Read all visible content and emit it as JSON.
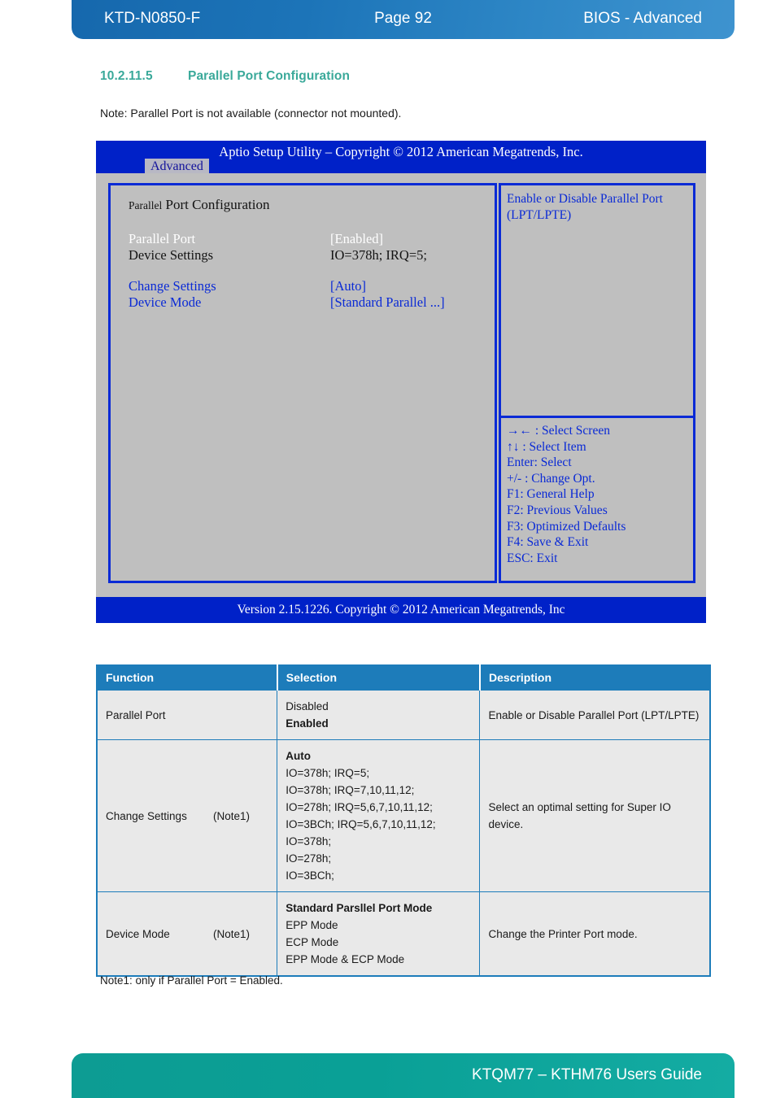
{
  "header": {
    "doc_id": "KTD-N0850-F",
    "page": "Page 92",
    "section": "BIOS - Advanced"
  },
  "section": {
    "number": "10.2.11.5",
    "title": "Parallel Port Configuration",
    "note": "Note: Parallel Port is not available (connector not mounted)."
  },
  "bios": {
    "title": "Aptio Setup Utility  –  Copyright © 2012 American Megatrends, Inc.",
    "tab": "Advanced",
    "panel_title_small": "Parallel",
    "panel_title_rest": " Port Configuration",
    "rows": [
      {
        "label": "Parallel Port",
        "value": "[Enabled]"
      },
      {
        "label": "Device Settings",
        "value": "IO=378h; IRQ=5;"
      },
      {
        "label": "Change Settings",
        "value": "[Auto]"
      },
      {
        "label": "Device Mode",
        "value": "[Standard Parallel ...]"
      }
    ],
    "help": "Enable or Disable Parallel Port (LPT/LPTE)",
    "keys": [
      "→← : Select Screen",
      "↑↓ : Select Item",
      "Enter: Select",
      "+/- : Change Opt.",
      "F1: General Help",
      "F2: Previous Values",
      "F3: Optimized Defaults",
      "F4: Save & Exit",
      "ESC: Exit"
    ],
    "version": "Version 2.15.1226. Copyright © 2012 American Megatrends, Inc"
  },
  "table": {
    "headers": {
      "function": "Function",
      "selection": "Selection",
      "description": "Description"
    },
    "rows": [
      {
        "function": "Parallel Port",
        "note": "",
        "options": [
          {
            "text": "Disabled",
            "bold": false
          },
          {
            "text": "Enabled",
            "bold": true
          }
        ],
        "description": "Enable or Disable Parallel Port (LPT/LPTE)"
      },
      {
        "function": "Change Settings",
        "note": "(Note1)",
        "options": [
          {
            "text": "Auto",
            "bold": true
          },
          {
            "text": "IO=378h; IRQ=5;",
            "bold": false
          },
          {
            "text": "IO=378h; IRQ=7,10,11,12;",
            "bold": false
          },
          {
            "text": "IO=278h; IRQ=5,6,7,10,11,12;",
            "bold": false
          },
          {
            "text": "IO=3BCh; IRQ=5,6,7,10,11,12;",
            "bold": false
          },
          {
            "text": "IO=378h;",
            "bold": false
          },
          {
            "text": "IO=278h;",
            "bold": false
          },
          {
            "text": "IO=3BCh;",
            "bold": false
          }
        ],
        "description": "Select an optimal setting for Super IO device."
      },
      {
        "function": "Device Mode",
        "note": "(Note1)",
        "options": [
          {
            "text": "Standard Parsllel Port Mode",
            "bold": true
          },
          {
            "text": "EPP Mode",
            "bold": false
          },
          {
            "text": "ECP Mode",
            "bold": false
          },
          {
            "text": "EPP Mode & ECP Mode",
            "bold": false
          }
        ],
        "description": "Change the Printer Port mode."
      }
    ]
  },
  "footnote": "Note1: only if Parallel Port = Enabled.",
  "footer": {
    "guide": "KTQM77 – KTHM76 Users Guide"
  },
  "colors": {
    "header_blue": "#1c74b8",
    "heading_teal": "#3aa99a",
    "footer_teal": "#0aa096",
    "bios_blue": "#0021c8",
    "bios_text_blue": "#0a2ad6",
    "bios_gray": "#bfbfbf",
    "table_header_blue": "#1d7cba"
  }
}
